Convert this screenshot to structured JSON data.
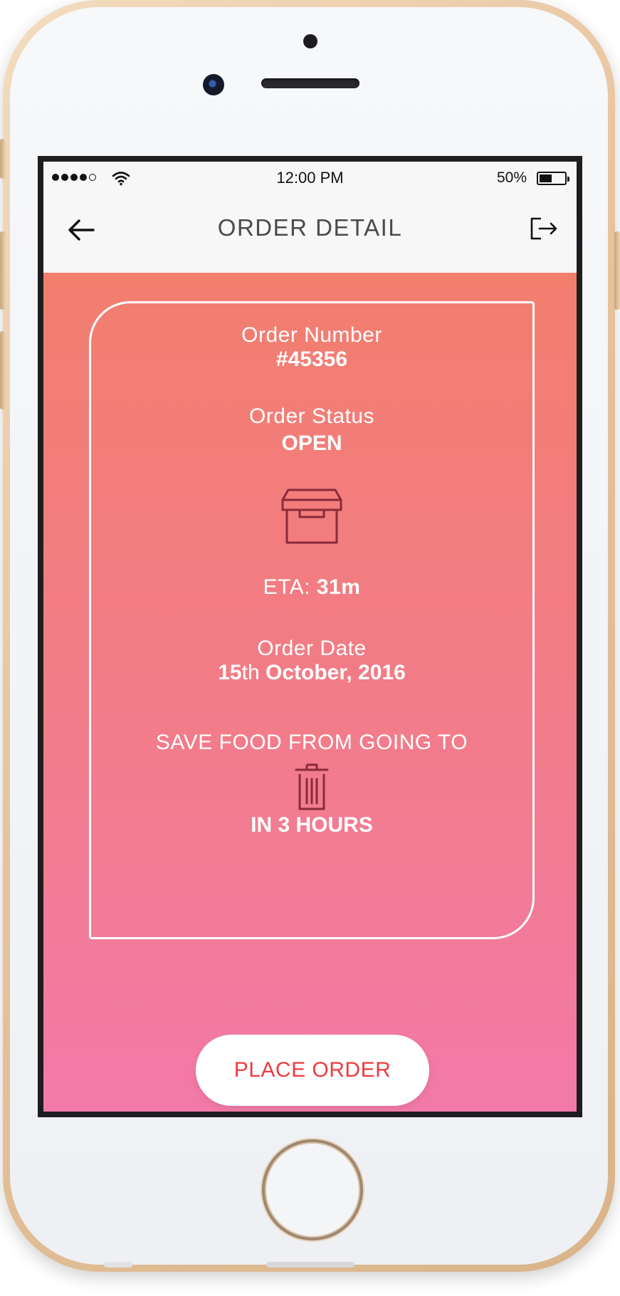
{
  "status_bar": {
    "time": "12:00 PM",
    "battery_percent": "50%",
    "battery_level": 0.45,
    "signal_bars_filled": 4,
    "signal_bars_total": 5
  },
  "header": {
    "title": "ORDER DETAIL",
    "back_icon": "arrow-left-icon",
    "logout_icon": "logout-icon"
  },
  "order": {
    "number_label": "Order Number",
    "number_value": "#45356",
    "status_label": "Order Status",
    "status_value": "OPEN",
    "status_icon": "archive-box-icon",
    "eta_label": "ETA:",
    "eta_value": "31m",
    "date_label": "Order Date",
    "date_day": "15",
    "date_suffix": "th",
    "date_rest": "October, 2016",
    "save_food_text": "SAVE FOOD FROM GOING TO",
    "save_food_icon": "trash-can-icon",
    "save_food_deadline": "IN 3 HOURS"
  },
  "action": {
    "place_order_label": "PLACE ORDER"
  },
  "colors": {
    "gradient_top": "#f27e6e",
    "gradient_bottom": "#f27aa8",
    "accent_red": "#ef3b3f",
    "icon_dark": "#8b2a3a"
  }
}
